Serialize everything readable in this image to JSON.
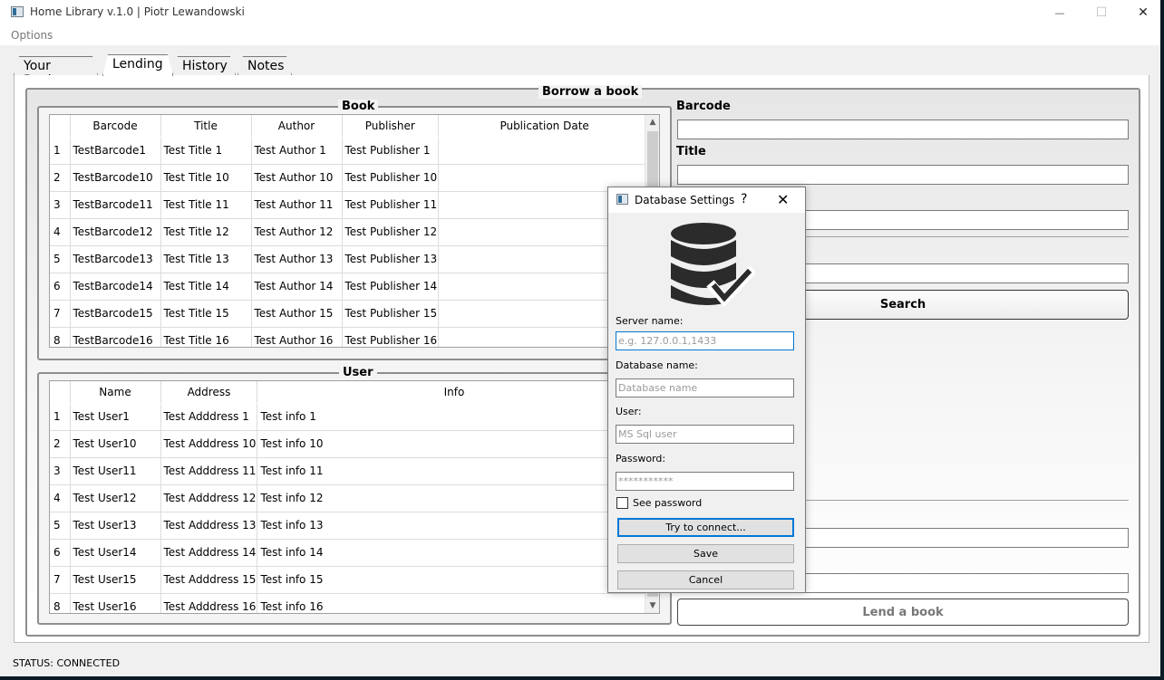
{
  "window": {
    "title": "Home Library v.1.0 | Piotr Lewandowski",
    "minimize_glyph": "—",
    "maximize_glyph": "☐",
    "close_glyph": "✕"
  },
  "menu": {
    "options_label": "Options"
  },
  "tabs": [
    {
      "label": "Your Books"
    },
    {
      "label": "Lending"
    },
    {
      "label": "History"
    },
    {
      "label": "Notes"
    }
  ],
  "borrow": {
    "title": "Borrow a book"
  },
  "book_group": {
    "title": "Book",
    "columns": [
      "Barcode",
      "Title",
      "Author",
      "Publisher",
      "Publication Date"
    ],
    "rows": [
      {
        "n": "1",
        "barcode": "TestBarcode1",
        "title": "Test Title 1",
        "author": "Test Author 1",
        "publisher": "Test Publisher 1",
        "date": ""
      },
      {
        "n": "2",
        "barcode": "TestBarcode10",
        "title": "Test Title 10",
        "author": "Test Author 10",
        "publisher": "Test Publisher 10",
        "date": ""
      },
      {
        "n": "3",
        "barcode": "TestBarcode11",
        "title": "Test Title 11",
        "author": "Test Author 11",
        "publisher": "Test Publisher 11",
        "date": ""
      },
      {
        "n": "4",
        "barcode": "TestBarcode12",
        "title": "Test Title 12",
        "author": "Test Author 12",
        "publisher": "Test Publisher 12",
        "date": ""
      },
      {
        "n": "5",
        "barcode": "TestBarcode13",
        "title": "Test Title 13",
        "author": "Test Author 13",
        "publisher": "Test Publisher 13",
        "date": ""
      },
      {
        "n": "6",
        "barcode": "TestBarcode14",
        "title": "Test Title 14",
        "author": "Test Author 14",
        "publisher": "Test Publisher 14",
        "date": ""
      },
      {
        "n": "7",
        "barcode": "TestBarcode15",
        "title": "Test Title 15",
        "author": "Test Author 15",
        "publisher": "Test Publisher 15",
        "date": ""
      },
      {
        "n": "8",
        "barcode": "TestBarcode16",
        "title": "Test Title 16",
        "author": "Test Author 16",
        "publisher": "Test Publisher 16",
        "date": ""
      }
    ]
  },
  "user_group": {
    "title": "User",
    "columns": [
      "Name",
      "Address",
      "Info"
    ],
    "rows": [
      {
        "n": "1",
        "name": "Test User1",
        "address": "Test Adddress 1",
        "info": "Test info 1"
      },
      {
        "n": "2",
        "name": "Test User10",
        "address": "Test Adddress 10",
        "info": "Test info 10"
      },
      {
        "n": "3",
        "name": "Test User11",
        "address": "Test Adddress 11",
        "info": "Test info 11"
      },
      {
        "n": "4",
        "name": "Test User12",
        "address": "Test Adddress 12",
        "info": "Test info 12"
      },
      {
        "n": "5",
        "name": "Test User13",
        "address": "Test Adddress 13",
        "info": "Test info 13"
      },
      {
        "n": "6",
        "name": "Test User14",
        "address": "Test Adddress 14",
        "info": "Test info 14"
      },
      {
        "n": "7",
        "name": "Test User15",
        "address": "Test Adddress 15",
        "info": "Test info 15"
      },
      {
        "n": "8",
        "name": "Test User16",
        "address": "Test Adddress 16",
        "info": "Test info 16"
      }
    ]
  },
  "search_panel": {
    "barcode_label": "Barcode",
    "title_label": "Title",
    "search_button": "Search",
    "lend_button": "Lend a book"
  },
  "status": {
    "text": "STATUS: CONNECTED"
  },
  "dialog": {
    "title": "Database Settings",
    "help_glyph": "?",
    "close_glyph": "✕",
    "server_label": "Server name:",
    "server_placeholder": "e.g. 127.0.0.1,1433",
    "database_label": "Database name:",
    "database_placeholder": "Database name",
    "user_label": "User:",
    "user_placeholder": "MS Sql user",
    "password_label": "Password:",
    "password_value": "***********",
    "see_password_label": "See password",
    "try_button": "Try to connect...",
    "save_button": "Save",
    "cancel_button": "Cancel"
  },
  "colors": {
    "focus_blue": "#0078d7",
    "groupbox_border": "#8e8e8e",
    "db_icon": "#2b2b2b"
  }
}
